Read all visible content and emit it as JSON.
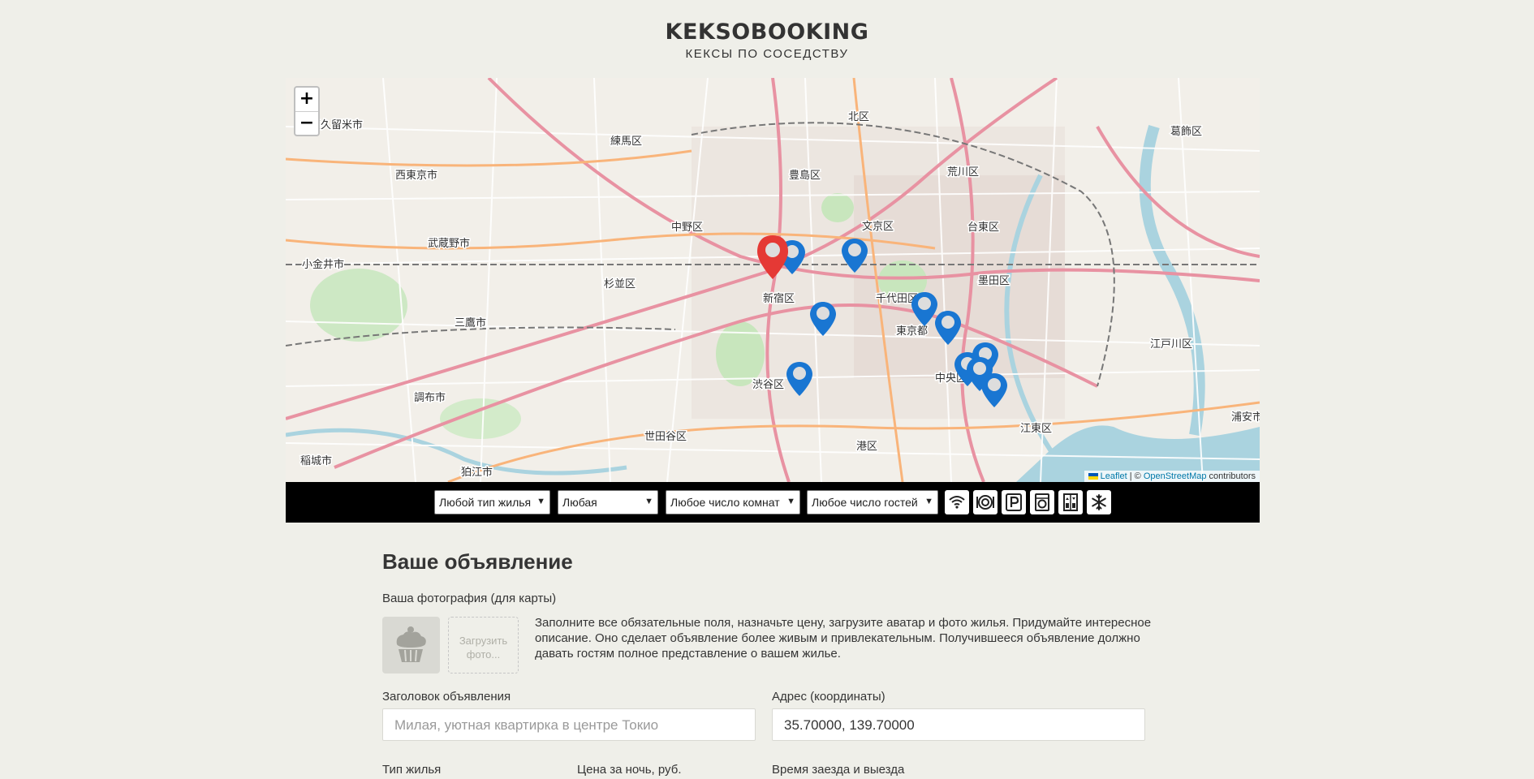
{
  "header": {
    "logo_title": "KEKSOBOOKING",
    "logo_subtitle": "КЕКСЫ ПО СОСЕДСТВУ"
  },
  "map": {
    "zoom_in": "+",
    "zoom_out": "−",
    "attribution": {
      "leaflet": "Leaflet",
      "separator": " | © ",
      "osm": "OpenStreetMap",
      "suffix": " contributors"
    },
    "place_labels": [
      "東久留米市",
      "練馬区",
      "北区",
      "荒川区",
      "葛飾区",
      "西東京市",
      "豊島区",
      "文京区",
      "台東区",
      "武蔵野市",
      "中野区",
      "小金井市",
      "杉並区",
      "新宿区",
      "千代田区",
      "墨田区",
      "三鷹市",
      "東京都",
      "江戸川区",
      "中央区",
      "渋谷区",
      "調布市",
      "港区",
      "江東区",
      "世田谷区",
      "稲城市",
      "狛江市",
      "浦安市"
    ],
    "main_pin_color": "#e53935",
    "pin_color": "#1976d2"
  },
  "filters": {
    "housing_type": "Любой тип жилья",
    "price": "Любая",
    "rooms": "Любое число комнат",
    "guests": "Любое число гостей",
    "features": [
      "wifi-icon",
      "dishwasher-icon",
      "parking-icon",
      "washer-icon",
      "elevator-icon",
      "conditioner-icon"
    ]
  },
  "form": {
    "title": "Ваше объявление",
    "avatar_label": "Ваша фотография (для карты)",
    "upload_label": "Загрузить фото...",
    "hint": "Заполните все обязательные поля, назначьте цену, загрузите аватар и фото жилья. Придумайте интересное описание. Оно сделает объявление более живым и привлекательным. Получившееся объявление должно давать гостям полное представление о вашем жилье.",
    "title_label": "Заголовок объявления",
    "title_placeholder": "Милая, уютная квартирка в центре Токио",
    "address_label": "Адрес (координаты)",
    "address_value": "35.70000, 139.70000",
    "type_label": "Тип жилья",
    "price_label": "Цена за ночь, руб.",
    "time_label": "Время заезда и выезда"
  }
}
